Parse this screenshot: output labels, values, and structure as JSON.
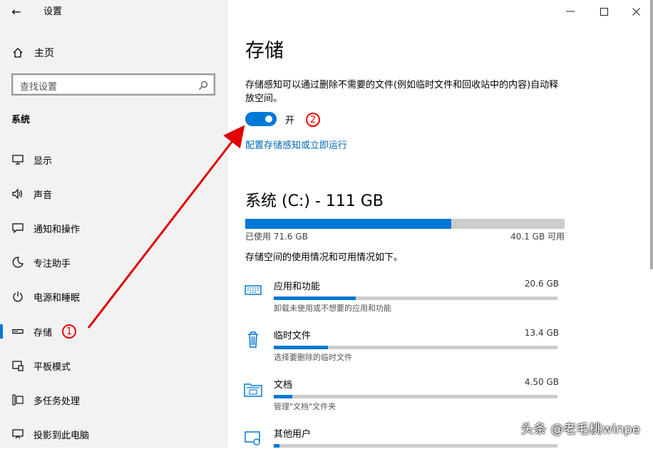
{
  "window": {
    "title": "设置"
  },
  "sidebar": {
    "home_label": "主页",
    "search_placeholder": "查找设置",
    "section_title": "系统",
    "items": [
      {
        "label": "显示",
        "icon": "monitor-icon"
      },
      {
        "label": "声音",
        "icon": "speaker-icon"
      },
      {
        "label": "通知和操作",
        "icon": "notification-icon"
      },
      {
        "label": "专注助手",
        "icon": "moon-icon"
      },
      {
        "label": "电源和睡眠",
        "icon": "power-icon"
      },
      {
        "label": "存储",
        "icon": "storage-icon",
        "active": true
      },
      {
        "label": "平板模式",
        "icon": "tablet-icon"
      },
      {
        "label": "多任务处理",
        "icon": "multitask-icon"
      },
      {
        "label": "投影到此电脑",
        "icon": "project-icon"
      }
    ]
  },
  "main": {
    "title": "存储",
    "description": "存储感知可以通过删除不需要的文件(例如临时文件和回收站中的内容)自动释放空间。",
    "toggle": {
      "state": "开",
      "on": true
    },
    "link": "配置存储感知或立即运行",
    "drive": {
      "title": "系统 (C:) - 111 GB",
      "used_label": "已使用 71.6 GB",
      "free_label": "40.1 GB 可用",
      "used_fraction": 0.644
    },
    "usage_desc": "存储空间的使用情况和可用情况如下。",
    "categories": [
      {
        "name": "应用和功能",
        "size": "20.6 GB",
        "sub": "卸载未使用或不想要的应用和功能",
        "fraction": 0.29,
        "icon": "keyboard-icon"
      },
      {
        "name": "临时文件",
        "size": "13.4 GB",
        "sub": "选择要删除的临时文件",
        "fraction": 0.19,
        "icon": "trash-icon"
      },
      {
        "name": "文档",
        "size": "4.50 GB",
        "sub": "管理\"文档\"文件夹",
        "fraction": 0.065,
        "icon": "folder-icon"
      },
      {
        "name": "其他用户",
        "size": "",
        "sub": "",
        "fraction": 0.02,
        "icon": "user-icon"
      }
    ]
  },
  "annotations": {
    "marker1": "1",
    "marker2": "2",
    "arrow_color": "#e00000"
  },
  "watermark": "头条 @老毛桃winpe",
  "colors": {
    "accent": "#0078d7",
    "link": "#0067b8",
    "sidebar_bg": "#f2f2f2"
  }
}
